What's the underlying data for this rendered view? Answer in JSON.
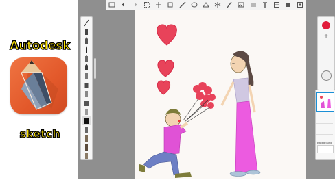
{
  "promo": {
    "brand": "Autodesk",
    "subtitle": "sketch",
    "icon": "autodesk-sketchbook-logo",
    "text_color": "#ffe400",
    "icon_color": "#e8622f"
  },
  "app": {
    "toolbar_icons": [
      "gallery-icon",
      "undo-icon",
      "redo-icon",
      "select-icon",
      "transform-icon",
      "crop-icon",
      "ruler-icon",
      "ellipse-icon",
      "perspective-icon",
      "symmetry-icon",
      "brush-icon",
      "image-icon",
      "guides-icon",
      "text-icon",
      "layers-icon",
      "canvas-icon",
      "fullscreen-icon"
    ],
    "brush_tools": [
      "brush-1",
      "brush-2",
      "brush-3",
      "brush-4",
      "brush-5",
      "brush-6",
      "brush-7",
      "brush-8",
      "brush-9",
      "brush-10",
      "brush-11",
      "brush-12",
      "brush-13",
      "brush-14",
      "brush-15",
      "brush-16"
    ],
    "color": {
      "current": "#e11b3a",
      "add_label": "+"
    },
    "layers": {
      "background_label": "Background"
    }
  }
}
